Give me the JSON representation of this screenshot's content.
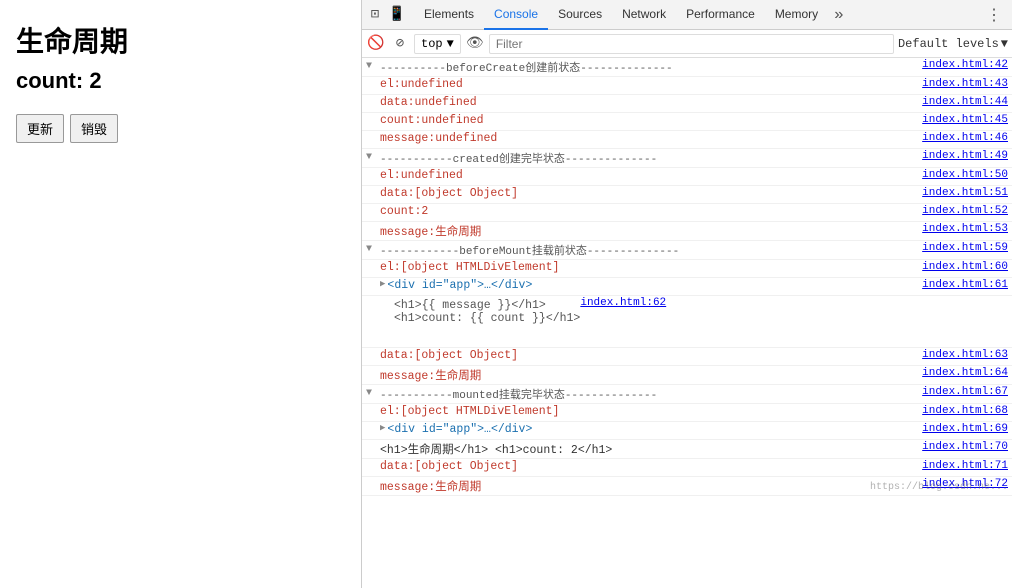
{
  "left": {
    "title": "生命周期",
    "subtitle": "count: 2",
    "btn_update": "更新",
    "btn_destroy": "销毁"
  },
  "devtools": {
    "tabs": [
      {
        "label": "Elements",
        "active": false
      },
      {
        "label": "Console",
        "active": true
      },
      {
        "label": "Sources",
        "active": false
      },
      {
        "label": "Network",
        "active": false
      },
      {
        "label": "Performance",
        "active": false
      },
      {
        "label": "Memory",
        "active": false
      }
    ],
    "toolbar": {
      "context": "top",
      "filter_placeholder": "Filter",
      "log_level": "Default levels"
    },
    "console_lines": [
      {
        "type": "separator",
        "indent": 0,
        "triangle": "▼",
        "text": "----------beforeCreate创建前状态--------------",
        "file": "index.html:42"
      },
      {
        "type": "normal",
        "indent": 1,
        "text": "el:undefined",
        "file": "index.html:43",
        "color": "red"
      },
      {
        "type": "normal",
        "indent": 1,
        "text": "data:undefined",
        "file": "index.html:44",
        "color": "red"
      },
      {
        "type": "normal",
        "indent": 1,
        "text": "count:undefined",
        "file": "index.html:45",
        "color": "red"
      },
      {
        "type": "normal",
        "indent": 1,
        "text": "message:undefined",
        "file": "index.html:46",
        "color": "red"
      },
      {
        "type": "separator",
        "indent": 0,
        "triangle": "▼",
        "text": "-----------created创建完毕状态--------------",
        "file": "index.html:49"
      },
      {
        "type": "normal",
        "indent": 1,
        "text": "el:undefined",
        "file": "index.html:50",
        "color": "red"
      },
      {
        "type": "normal",
        "indent": 1,
        "text": "data:[object Object]",
        "file": "index.html:51",
        "color": "red"
      },
      {
        "type": "normal",
        "indent": 1,
        "text": "count:2",
        "file": "index.html:52",
        "color": "red"
      },
      {
        "type": "normal",
        "indent": 1,
        "text": "message:生命周期",
        "file": "index.html:53",
        "color": "red"
      },
      {
        "type": "separator",
        "indent": 0,
        "triangle": "▼",
        "text": "------------beforeMount挂载前状态--------------",
        "file": "index.html:59"
      },
      {
        "type": "normal",
        "indent": 1,
        "text": "el:[object HTMLDivElement]",
        "file": "index.html:60",
        "color": "red"
      },
      {
        "type": "expandable",
        "indent": 1,
        "expand": "▶",
        "text": "<div id=\"app\">…</div>",
        "file": "index.html:61",
        "color": "blue"
      },
      {
        "type": "blank",
        "indent": 0,
        "text": "",
        "file": "index.html:62"
      },
      {
        "type": "code_block",
        "indent": 2,
        "lines": [
          "<h1>{{ message }}</h1>",
          "<h1>count: {{ count }}</h1>"
        ]
      },
      {
        "type": "normal",
        "indent": 1,
        "text": "data:[object Object]",
        "file": "index.html:63",
        "color": "red"
      },
      {
        "type": "normal",
        "indent": 1,
        "text": "message:生命周期",
        "file": "index.html:64",
        "color": "red"
      },
      {
        "type": "separator",
        "indent": 0,
        "triangle": "▼",
        "text": "-----------mounted挂载完毕状态--------------",
        "file": "index.html:67"
      },
      {
        "type": "normal",
        "indent": 1,
        "text": "el:[object HTMLDivElement]",
        "file": "index.html:68",
        "color": "red"
      },
      {
        "type": "expandable",
        "indent": 1,
        "expand": "▶",
        "text": "<div id=\"app\">…</div>",
        "file": "index.html:69",
        "color": "blue"
      },
      {
        "type": "normal",
        "indent": 1,
        "text": "<h1>生命周期</h1>  <h1>count: 2</h1>",
        "file": "index.html:70",
        "color": "dark"
      },
      {
        "type": "normal",
        "indent": 1,
        "text": "data:[object Object]",
        "file": "index.html:71",
        "color": "red"
      },
      {
        "type": "normal",
        "indent": 1,
        "text": "message:生命周期",
        "file": "index.html:72",
        "color": "red"
      }
    ]
  },
  "watermark": "https://blog.csdn.ne..."
}
